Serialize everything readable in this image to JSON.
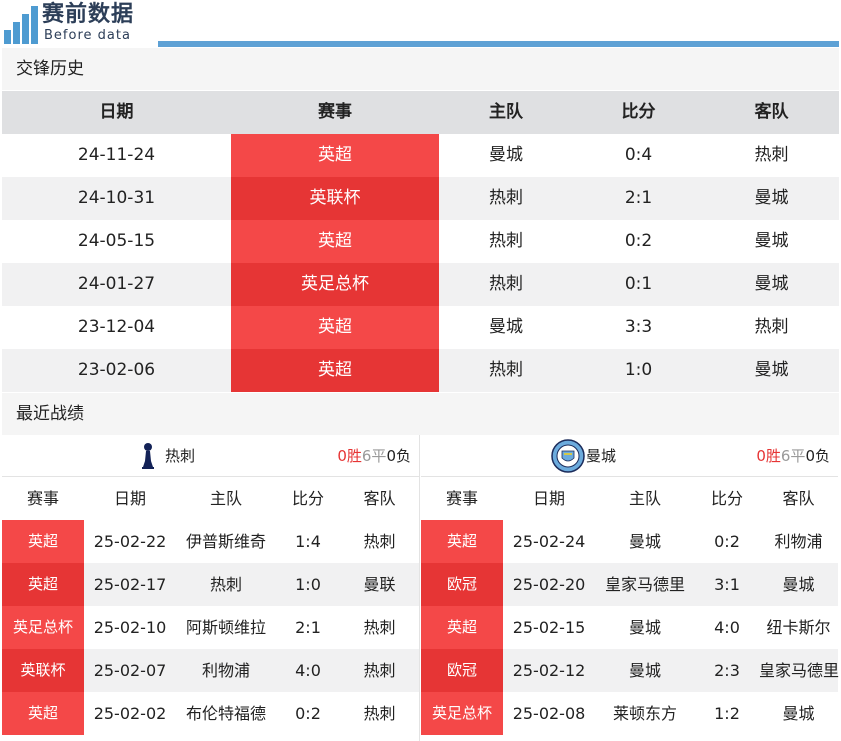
{
  "header": {
    "logo_title": "赛前数据",
    "logo_sub": "Before data"
  },
  "h2h": {
    "section_title": "交锋历史",
    "columns": {
      "date": "日期",
      "competition": "赛事",
      "home": "主队",
      "score": "比分",
      "away": "客队"
    },
    "rows": [
      {
        "date": "24-11-24",
        "competition": "英超",
        "home": "曼城",
        "score": "0:4",
        "away": "热刺"
      },
      {
        "date": "24-10-31",
        "competition": "英联杯",
        "home": "热刺",
        "score": "2:1",
        "away": "曼城"
      },
      {
        "date": "24-05-15",
        "competition": "英超",
        "home": "热刺",
        "score": "0:2",
        "away": "曼城"
      },
      {
        "date": "24-01-27",
        "competition": "英足总杯",
        "home": "热刺",
        "score": "0:1",
        "away": "曼城"
      },
      {
        "date": "23-12-04",
        "competition": "英超",
        "home": "曼城",
        "score": "3:3",
        "away": "热刺"
      },
      {
        "date": "23-02-06",
        "competition": "英超",
        "home": "热刺",
        "score": "1:0",
        "away": "曼城"
      }
    ]
  },
  "recent": {
    "section_title": "最近战绩",
    "columns": {
      "competition": "赛事",
      "date": "日期",
      "home": "主队",
      "score": "比分",
      "away": "客队"
    },
    "left": {
      "team": "热刺",
      "icon": "tottenham-crest-icon",
      "wins": "0",
      "win_label": "胜",
      "draws": "6",
      "draw_label": "平",
      "losses": "0",
      "loss_label": "负",
      "rows": [
        {
          "competition": "英超",
          "date": "25-02-22",
          "home": "伊普斯维奇",
          "score": "1:4",
          "away": "热刺"
        },
        {
          "competition": "英超",
          "date": "25-02-17",
          "home": "热刺",
          "score": "1:0",
          "away": "曼联"
        },
        {
          "competition": "英足总杯",
          "date": "25-02-10",
          "home": "阿斯顿维拉",
          "score": "2:1",
          "away": "热刺"
        },
        {
          "competition": "英联杯",
          "date": "25-02-07",
          "home": "利物浦",
          "score": "4:0",
          "away": "热刺"
        },
        {
          "competition": "英超",
          "date": "25-02-02",
          "home": "布伦特福德",
          "score": "0:2",
          "away": "热刺"
        }
      ]
    },
    "right": {
      "team": "曼城",
      "icon": "man-city-crest-icon",
      "wins": "0",
      "win_label": "胜",
      "draws": "6",
      "draw_label": "平",
      "losses": "0",
      "loss_label": "负",
      "rows": [
        {
          "competition": "英超",
          "date": "25-02-24",
          "home": "曼城",
          "score": "0:2",
          "away": "利物浦"
        },
        {
          "competition": "欧冠",
          "date": "25-02-20",
          "home": "皇家马德里",
          "score": "3:1",
          "away": "曼城"
        },
        {
          "competition": "英超",
          "date": "25-02-15",
          "home": "曼城",
          "score": "4:0",
          "away": "纽卡斯尔"
        },
        {
          "competition": "欧冠",
          "date": "25-02-12",
          "home": "曼城",
          "score": "2:3",
          "away": "皇家马德里"
        },
        {
          "competition": "英足总杯",
          "date": "25-02-08",
          "home": "莱顿东方",
          "score": "1:2",
          "away": "曼城"
        }
      ]
    }
  },
  "colors": {
    "accent_red": "#f44848",
    "accent_red_dark": "#e63535",
    "header_blue": "#5ea1d5",
    "logo_navy": "#2c3e58"
  }
}
